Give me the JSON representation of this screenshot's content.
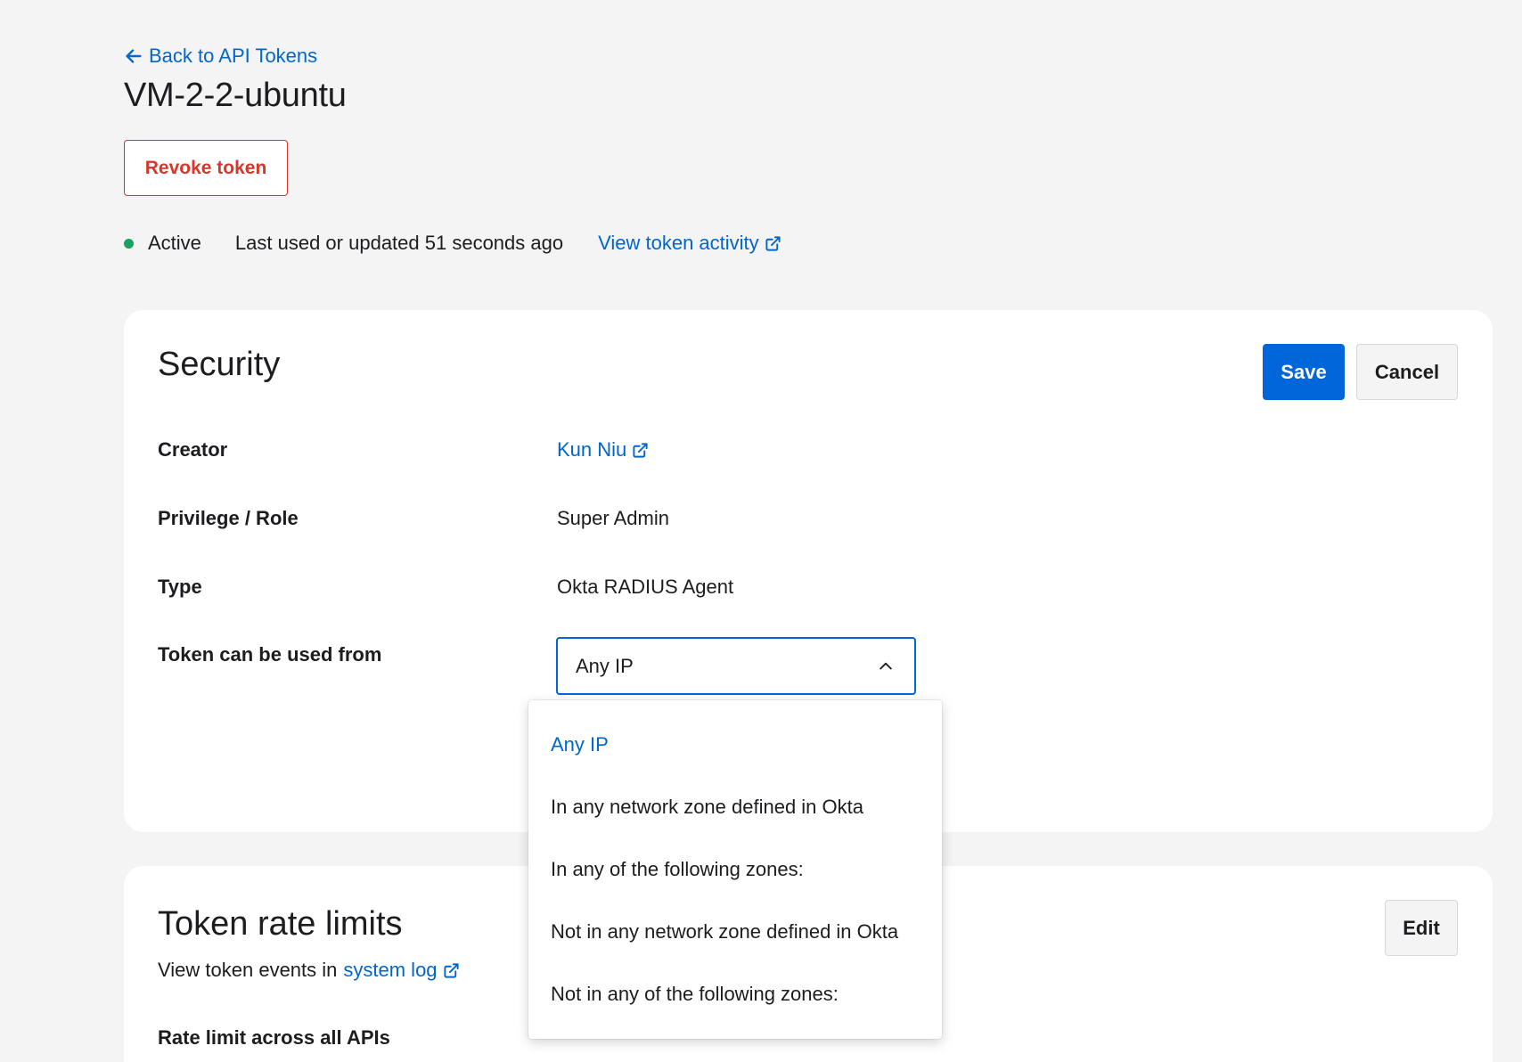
{
  "header": {
    "back_label": "Back to API Tokens",
    "title": "VM-2-2-ubuntu",
    "revoke_label": "Revoke token"
  },
  "status": {
    "state": "Active",
    "last_used": "Last used or updated 51 seconds ago",
    "activity_link": "View token activity"
  },
  "security": {
    "title": "Security",
    "save_label": "Save",
    "cancel_label": "Cancel",
    "fields": {
      "creator_label": "Creator",
      "creator_value": "Kun Niu",
      "privilege_label": "Privilege / Role",
      "privilege_value": "Super Admin",
      "type_label": "Type",
      "type_value": "Okta RADIUS Agent",
      "used_from_label": "Token can be used from",
      "used_from_value": "Any IP"
    },
    "dropdown": {
      "options": [
        "Any IP",
        "In any network zone defined in Okta",
        "In any of the following zones:",
        "Not in any network zone defined in Okta",
        "Not in any of the following zones:"
      ],
      "selected_index": 0
    }
  },
  "rate_limits": {
    "title": "Token rate limits",
    "edit_label": "Edit",
    "subtitle_prefix": "View token events in",
    "subtitle_link": "system log",
    "rate_label": "Rate limit across all APIs"
  },
  "colors": {
    "accent": "#0066d9",
    "link": "#0066cc",
    "danger": "#d9362b",
    "active": "#17a461",
    "background": "#f4f4f4"
  },
  "icons": [
    "arrow-left-icon",
    "external-link-icon",
    "chevron-up-icon"
  ]
}
